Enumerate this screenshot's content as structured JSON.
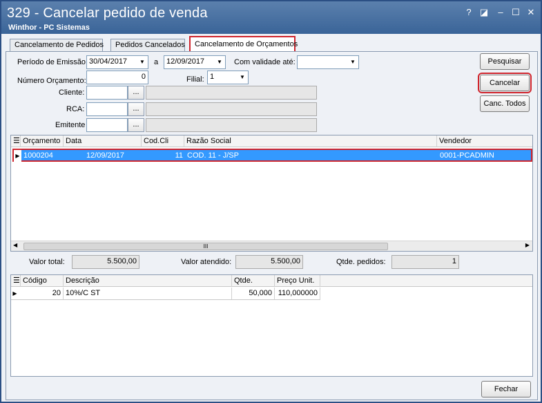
{
  "window": {
    "title": "329 - Cancelar pedido de venda",
    "subtitle": "Winthor - PC Sistemas",
    "help_glyph": "?",
    "restore_glyph": "◪",
    "minimize_glyph": "–",
    "maximize_glyph": "☐",
    "close_glyph": "✕"
  },
  "tabs": [
    {
      "label": "Cancelamento de Pedidos"
    },
    {
      "label": "Pedidos Cancelados"
    },
    {
      "label": "Cancelamento de Orçamentos"
    }
  ],
  "filters": {
    "periodo_label": "Período de Emissão:",
    "data_inicio": "30/04/2017",
    "a_label": "a",
    "data_fim": "12/09/2017",
    "validade_label": "Com validade até:",
    "validade_value": "",
    "numero_label": "Número Orçamento:",
    "numero_value": "0",
    "filial_label": "Filial:",
    "filial_value": "1",
    "cliente_label": "Cliente:",
    "rca_label": "RCA:",
    "emitente_label": "Emitente",
    "ellipsis": "..."
  },
  "buttons": {
    "pesquisar": "Pesquisar",
    "cancelar": "Cancelar",
    "canc_todos": "Canc. Todos",
    "fechar": "Fechar"
  },
  "orcamentos_grid": {
    "columns": [
      "Orçamento",
      "Data",
      "Cod.Cli",
      "Razão Social",
      "Vendedor"
    ],
    "rows": [
      {
        "orcamento": "1000204",
        "data": "12/09/2017",
        "codcli": "11",
        "razao": "COD. 11 - J/SP",
        "vendedor": "0001-PCADMIN"
      }
    ],
    "scroll_grip": "III"
  },
  "totals": {
    "valor_total_label": "Valor total:",
    "valor_total": "5.500,00",
    "valor_atendido_label": "Valor atendido:",
    "valor_atendido": "5.500,00",
    "qtde_pedidos_label": "Qtde. pedidos:",
    "qtde_pedidos": "1"
  },
  "itens_grid": {
    "columns": [
      "Código",
      "Descrição",
      "Qtde.",
      "Preço Unit."
    ],
    "rows": [
      {
        "codigo": "20",
        "descricao": "10%/C ST",
        "qtde": "50,000",
        "preco": "110,000000"
      }
    ]
  },
  "colors": {
    "titlebar": "#3a6498",
    "selection": "#3399ff",
    "highlight": "#d0242c"
  }
}
